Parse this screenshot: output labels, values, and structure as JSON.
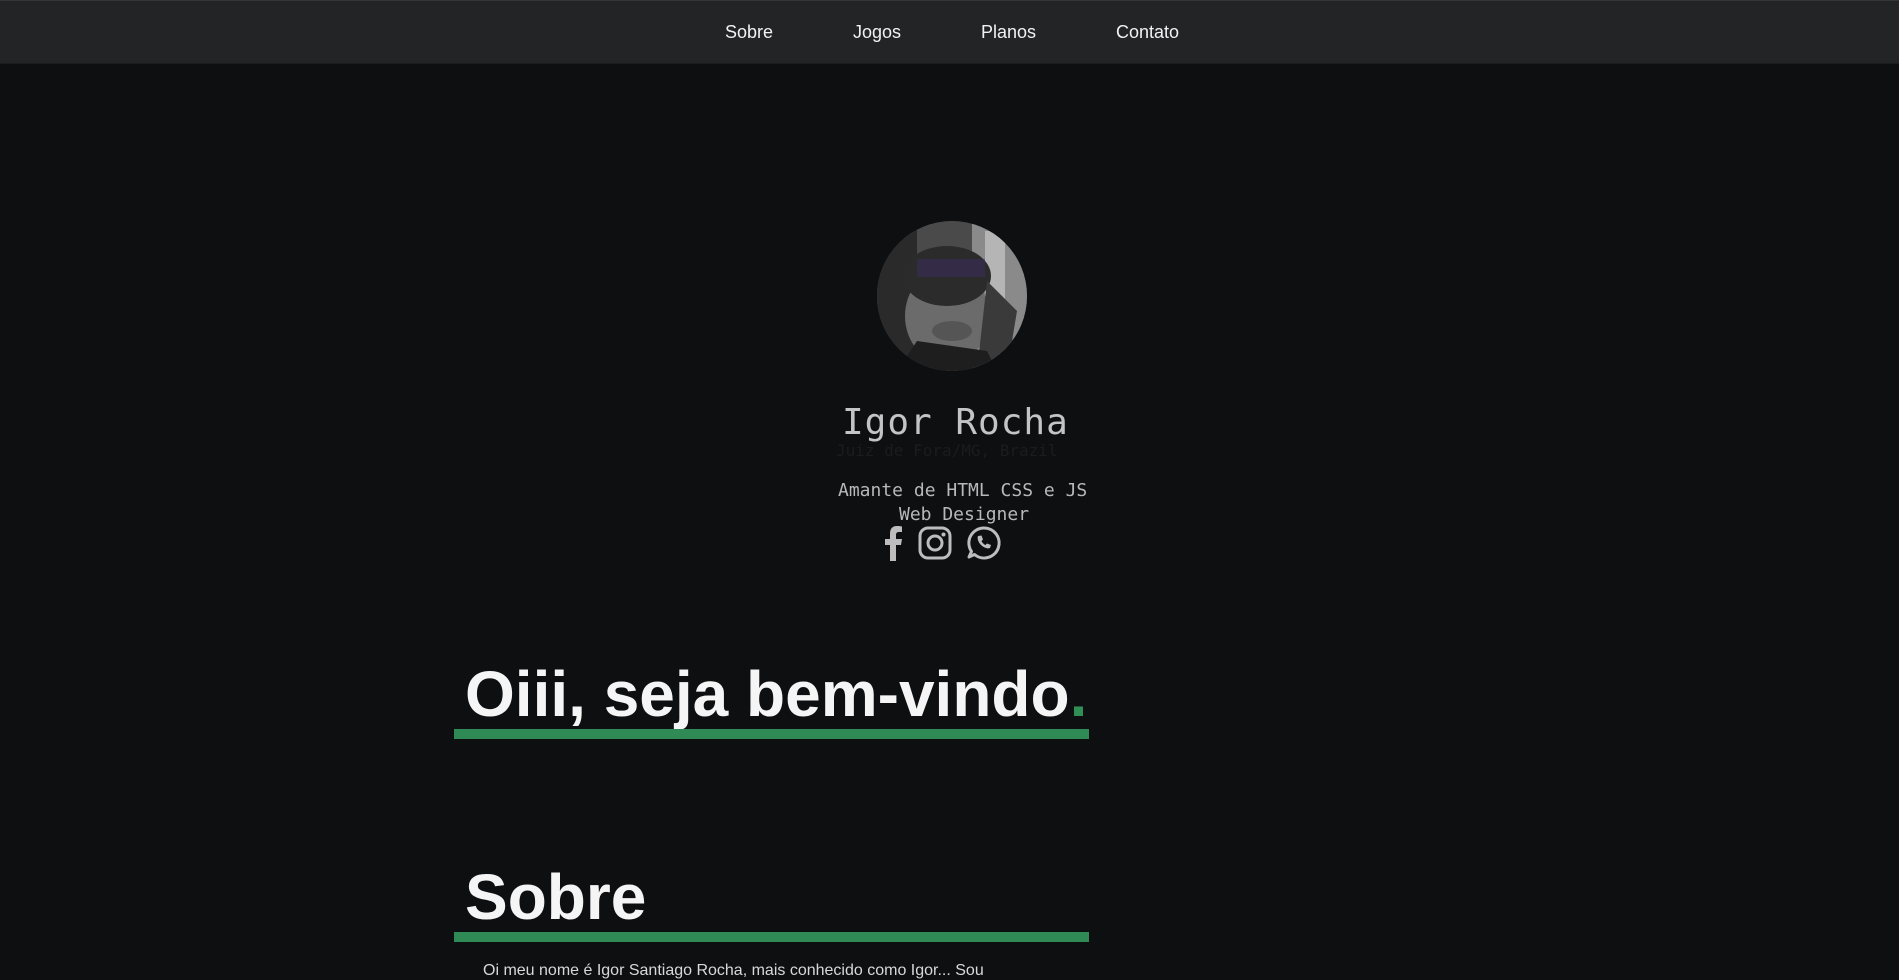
{
  "nav": {
    "items": [
      {
        "label": "Sobre"
      },
      {
        "label": "Jogos"
      },
      {
        "label": "Planos"
      },
      {
        "label": "Contato"
      }
    ]
  },
  "profile": {
    "name": "Igor Rocha",
    "location": "Juiz de Fora/MG, Brazil",
    "tagline": "Amante de HTML CSS e JS",
    "role": "Web Designer",
    "social": [
      {
        "icon": "facebook-icon"
      },
      {
        "icon": "instagram-icon"
      },
      {
        "icon": "whatsapp-icon"
      }
    ]
  },
  "welcome": {
    "heading": "Oiii, seja bem-vindo",
    "accent": "."
  },
  "sobre": {
    "heading": "Sobre",
    "text": "Oi meu nome é Igor Santiago Rocha, mais conhecido como Igor... Sou"
  },
  "colors": {
    "background": "#0d0f11",
    "navbar": "#222426",
    "accent": "#2f8a55"
  }
}
